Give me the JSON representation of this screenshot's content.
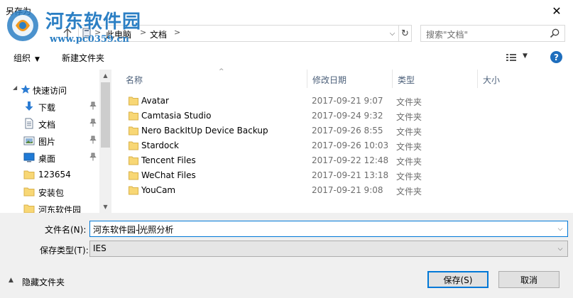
{
  "window": {
    "title": "另存为",
    "close_glyph": "✕"
  },
  "watermark": {
    "site_name": "河东软件园",
    "url": "www.pc0359.cn"
  },
  "address_bar": {
    "segments": [
      "此电脑",
      "文档"
    ],
    "separator": ">"
  },
  "search": {
    "placeholder": "搜索\"文档\""
  },
  "toolbar": {
    "organize_label": "组织",
    "new_folder_label": "新建文件夹",
    "help_label": "?"
  },
  "nav_pane": {
    "items": [
      {
        "label": "快速访问",
        "icon": "star-icon",
        "pinned": false
      },
      {
        "label": "下载",
        "icon": "download-icon",
        "pinned": true
      },
      {
        "label": "文档",
        "icon": "document-icon",
        "pinned": true
      },
      {
        "label": "图片",
        "icon": "picture-icon",
        "pinned": true
      },
      {
        "label": "桌面",
        "icon": "desktop-icon",
        "pinned": true
      },
      {
        "label": "123654",
        "icon": "folder-icon",
        "pinned": false
      },
      {
        "label": "安装包",
        "icon": "folder-icon",
        "pinned": false
      },
      {
        "label": "河东软件园",
        "icon": "folder-icon",
        "pinned": false
      }
    ]
  },
  "file_list": {
    "columns": [
      "名称",
      "修改日期",
      "类型",
      "大小"
    ],
    "rows": [
      {
        "name": "Avatar",
        "date": "2017-09-21 9:07",
        "type": "文件夹"
      },
      {
        "name": "Camtasia Studio",
        "date": "2017-09-24 9:32",
        "type": "文件夹"
      },
      {
        "name": "Nero BackItUp Device Backup",
        "date": "2017-09-26 8:55",
        "type": "文件夹"
      },
      {
        "name": "Stardock",
        "date": "2017-09-26 10:03",
        "type": "文件夹"
      },
      {
        "name": "Tencent Files",
        "date": "2017-09-22 12:48",
        "type": "文件夹"
      },
      {
        "name": "WeChat Files",
        "date": "2017-09-21 13:18",
        "type": "文件夹"
      },
      {
        "name": "YouCam",
        "date": "2017-09-21 9:08",
        "type": "文件夹"
      }
    ]
  },
  "bottom": {
    "filename_label": "文件名(N):",
    "filename_before_caret": "河东软件园-",
    "filename_after_caret": "光照分析",
    "filetype_label": "保存类型(T):",
    "filetype_value": "IES",
    "hide_folders_label": "隐藏文件夹",
    "save_label": "保存(S)",
    "cancel_label": "取消"
  },
  "colors": {
    "accent": "#0078d7",
    "folder": "#f8d775",
    "header_text": "#4c607a",
    "help_blue": "#1f6ebd"
  }
}
